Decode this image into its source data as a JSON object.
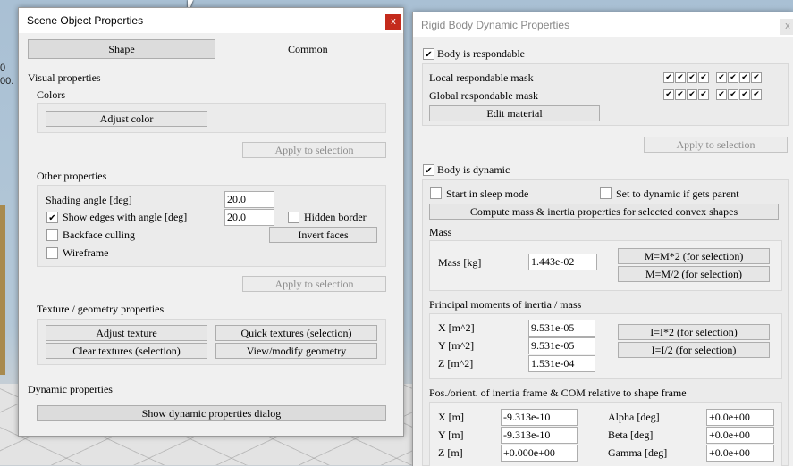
{
  "scene": {
    "side_text_1": "0",
    "side_text_2": "00."
  },
  "left_dialog": {
    "title": "Scene Object Properties",
    "close": "x",
    "tabs": [
      "Shape",
      "Common"
    ],
    "visual_properties": "Visual properties",
    "colors": "Colors",
    "adjust_color": "Adjust color",
    "apply_to_selection": "Apply to selection",
    "other_properties": "Other properties",
    "shading_angle_label": "Shading angle [deg]",
    "shading_angle_value": "20.0",
    "show_edges_label": "Show edges with angle [deg]",
    "show_edges_value": "20.0",
    "hidden_border": "Hidden border",
    "backface_culling": "Backface culling",
    "invert_faces": "Invert faces",
    "wireframe": "Wireframe",
    "texture_geometry": "Texture / geometry properties",
    "adjust_texture": "Adjust texture",
    "quick_textures": "Quick textures (selection)",
    "clear_textures": "Clear textures (selection)",
    "view_modify_geometry": "View/modify geometry",
    "dynamic_properties": "Dynamic properties",
    "show_dynamic_dialog": "Show dynamic properties dialog"
  },
  "right_dialog": {
    "title": "Rigid Body Dynamic Properties",
    "close": "x",
    "body_respondable": "Body is respondable",
    "local_mask": "Local respondable mask",
    "global_mask": "Global respondable mask",
    "edit_material": "Edit material",
    "apply_to_selection": "Apply to selection",
    "body_dynamic": "Body is dynamic",
    "start_sleep": "Start in sleep mode",
    "set_dynamic_parent": "Set to dynamic if gets parent",
    "compute_mass": "Compute mass & inertia properties for selected convex shapes",
    "mass_header": "Mass",
    "mass_label": "Mass [kg]",
    "mass_value": "1.443e-02",
    "mass_x2": "M=M*2  (for selection)",
    "mass_div2": "M=M/2  (for selection)",
    "inertia_header": "Principal moments of inertia / mass",
    "ix_label": "X [m^2]",
    "ix_value": "9.531e-05",
    "iy_label": "Y [m^2]",
    "iy_value": "9.531e-05",
    "iz_label": "Z [m^2]",
    "iz_value": "1.531e-04",
    "inertia_x2": "I=I*2  (for selection)",
    "inertia_div2": "I=I/2  (for selection)",
    "pos_header": "Pos./orient. of inertia frame & COM relative to shape frame",
    "px_label": "X [m]",
    "px_value": "-9.313e-10",
    "py_label": "Y [m]",
    "py_value": "-9.313e-10",
    "pz_label": "Z [m]",
    "pz_value": "+0.000e+00",
    "alpha_label": "Alpha [deg]",
    "alpha_value": "+0.0e+00",
    "beta_label": "Beta [deg]",
    "beta_value": "+0.0e+00",
    "gamma_label": "Gamma [deg]",
    "gamma_value": "+0.0e+00"
  }
}
